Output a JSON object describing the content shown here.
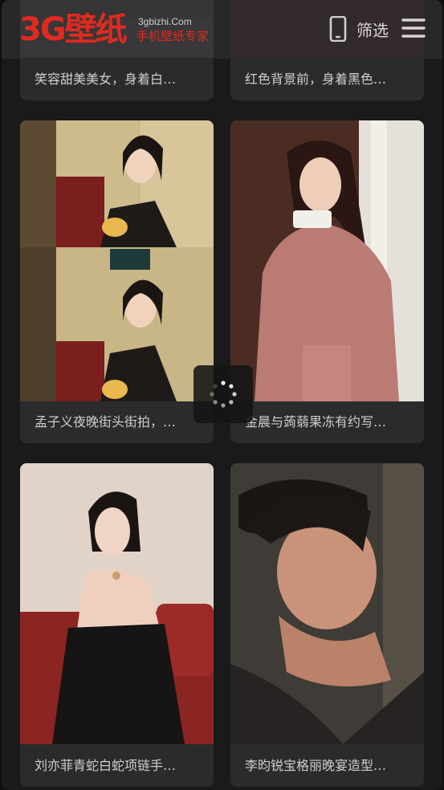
{
  "header": {
    "logo_text": "3G壁纸",
    "logo_domain": "3gbizhi.Com",
    "logo_slogan": "手机壁纸专家",
    "filter_label": "筛选"
  },
  "cards": [
    {
      "title": "笑容甜美美女，身着白…"
    },
    {
      "title": "红色背景前，身着黑色…"
    },
    {
      "title": "孟子义夜晚街头街拍，…"
    },
    {
      "title": "金晨与蒟蒻果冻有约写…"
    },
    {
      "title": "刘亦菲青蛇白蛇项链手…"
    },
    {
      "title": "李昀锐宝格丽晚宴造型…"
    }
  ],
  "colors": {
    "brand_red": "#e02a1f",
    "background": "#1a1a1a",
    "card_bg": "#2b2b2d",
    "caption_text": "#cfcfcf"
  }
}
